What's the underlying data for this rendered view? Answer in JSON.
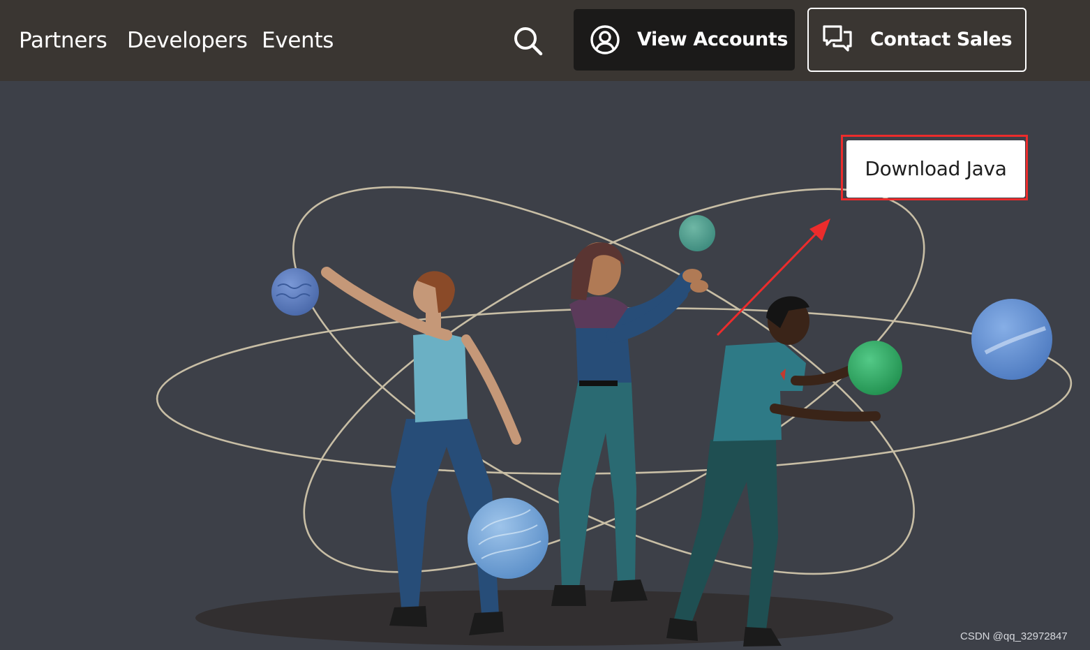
{
  "nav": {
    "links": [
      "Partners",
      "Developers",
      "Events"
    ],
    "search_icon": "search-icon"
  },
  "header_buttons": {
    "accounts": {
      "label": "View Accounts",
      "icon": "user-circle-icon"
    },
    "sales": {
      "label": "Contact Sales",
      "icon": "chat-bubbles-icon"
    }
  },
  "hero": {
    "download_label": "Download Java",
    "highlight_color": "#ec2c2c"
  },
  "watermark": "CSDN @qq_32972847",
  "colors": {
    "header_bg": "#3a3632",
    "hero_bg": "#3d4048",
    "accounts_btn_bg": "#1b1a19"
  }
}
